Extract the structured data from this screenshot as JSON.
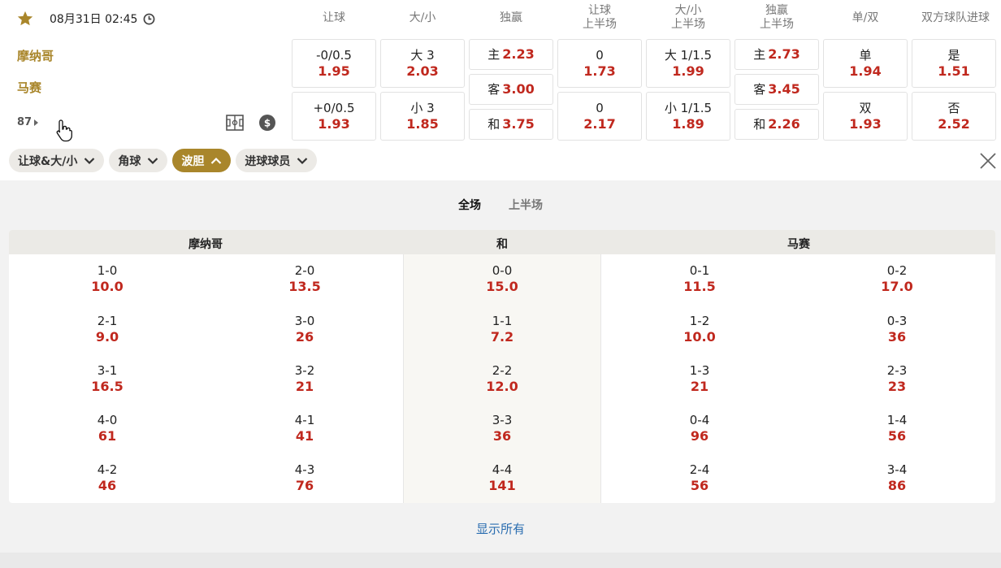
{
  "match": {
    "datetime": "08月31日 02:45",
    "home": "摩纳哥",
    "away": "马赛",
    "more_markets": "87"
  },
  "market_headers": [
    {
      "line1": "让球",
      "line2": ""
    },
    {
      "line1": "大/小",
      "line2": ""
    },
    {
      "line1": "独赢",
      "line2": ""
    },
    {
      "line1": "让球",
      "line2": "上半场"
    },
    {
      "line1": "大/小",
      "line2": "上半场"
    },
    {
      "line1": "独赢",
      "line2": "上半场"
    },
    {
      "line1": "单/双",
      "line2": ""
    },
    {
      "line1": "双方球队进球",
      "line2": ""
    }
  ],
  "handicap": [
    {
      "label": "-0/0.5",
      "odds": "1.95"
    },
    {
      "label": "+0/0.5",
      "odds": "1.93"
    }
  ],
  "over_under": [
    {
      "label": "大 3",
      "odds": "2.03"
    },
    {
      "label": "小 3",
      "odds": "1.85"
    }
  ],
  "moneyline": [
    {
      "label": "主",
      "odds": "2.23"
    },
    {
      "label": "客",
      "odds": "3.00"
    },
    {
      "label": "和",
      "odds": "3.75"
    }
  ],
  "handicap_1h": [
    {
      "label": "0",
      "odds": "1.73"
    },
    {
      "label": "0",
      "odds": "2.17"
    }
  ],
  "over_under_1h": [
    {
      "label": "大 1/1.5",
      "odds": "1.99"
    },
    {
      "label": "小 1/1.5",
      "odds": "1.89"
    }
  ],
  "moneyline_1h": [
    {
      "label": "主",
      "odds": "2.73"
    },
    {
      "label": "客",
      "odds": "3.45"
    },
    {
      "label": "和",
      "odds": "2.26"
    }
  ],
  "odd_even": [
    {
      "label": "单",
      "odds": "1.94"
    },
    {
      "label": "双",
      "odds": "1.93"
    }
  ],
  "btts": [
    {
      "label": "是",
      "odds": "1.51"
    },
    {
      "label": "否",
      "odds": "2.52"
    }
  ],
  "filters": [
    "让球&大/小",
    "角球",
    "波胆",
    "进球球员"
  ],
  "period_tabs": [
    "全场",
    "上半场"
  ],
  "correct_score": {
    "headers": {
      "home": "摩纳哥",
      "draw": "和",
      "away": "马赛"
    },
    "rows": [
      [
        [
          "1-0",
          "10.0"
        ],
        [
          "2-0",
          "13.5"
        ],
        [
          "0-0",
          "15.0"
        ],
        [
          "0-1",
          "11.5"
        ],
        [
          "0-2",
          "17.0"
        ]
      ],
      [
        [
          "2-1",
          "9.0"
        ],
        [
          "3-0",
          "26"
        ],
        [
          "1-1",
          "7.2"
        ],
        [
          "1-2",
          "10.0"
        ],
        [
          "0-3",
          "36"
        ]
      ],
      [
        [
          "3-1",
          "16.5"
        ],
        [
          "3-2",
          "21"
        ],
        [
          "2-2",
          "12.0"
        ],
        [
          "1-3",
          "21"
        ],
        [
          "2-3",
          "23"
        ]
      ],
      [
        [
          "4-0",
          "61"
        ],
        [
          "4-1",
          "41"
        ],
        [
          "3-3",
          "36"
        ],
        [
          "0-4",
          "96"
        ],
        [
          "1-4",
          "56"
        ]
      ],
      [
        [
          "4-2",
          "46"
        ],
        [
          "4-3",
          "76"
        ],
        [
          "4-4",
          "141"
        ],
        [
          "2-4",
          "56"
        ],
        [
          "3-4",
          "86"
        ]
      ]
    ]
  },
  "show_all": "显示所有",
  "colors": {
    "gold": "#a9862b",
    "odds_red": "#c0281e",
    "link_blue": "#2a6db0"
  }
}
